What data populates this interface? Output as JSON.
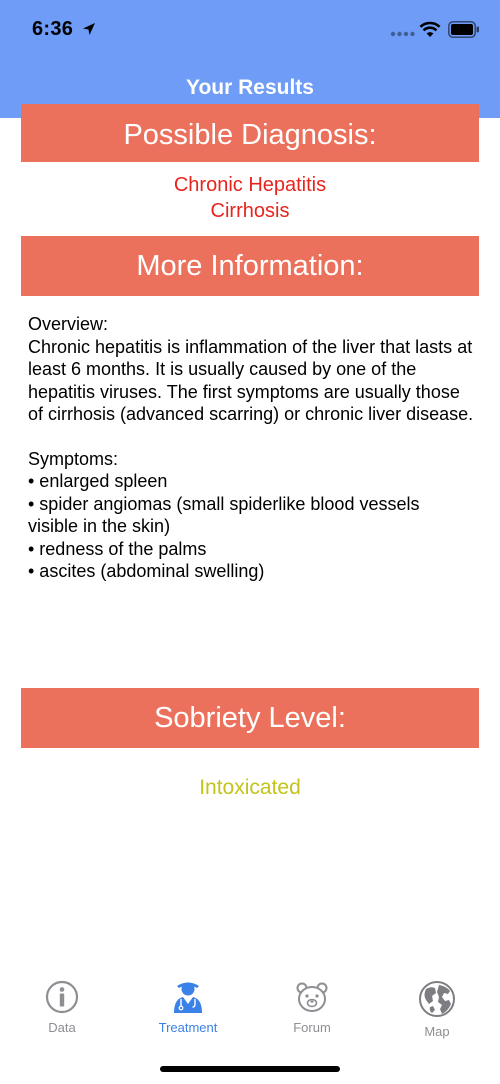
{
  "status_bar": {
    "time": "6:36"
  },
  "nav": {
    "title": "Your Results"
  },
  "sections": {
    "diagnosis_header": "Possible Diagnosis:",
    "diagnoses": [
      "Chronic Hepatitis",
      "Cirrhosis"
    ],
    "more_info_header": "More Information:",
    "sobriety_header": "Sobriety Level:",
    "sobriety_value": "Intoxicated"
  },
  "info": {
    "overview_label": "Overview:",
    "overview_text": "Chronic hepatitis is inflammation of the liver that lasts at least 6 months. It is usually caused by one of the hepatitis viruses. The first symptoms are usually those of cirrhosis (advanced scarring) or chronic liver disease.",
    "symptoms_label": "Symptoms:",
    "symptoms": [
      "• enlarged spleen",
      "• spider angiomas (small spiderlike blood vessels visible in the skin)",
      "• redness of the palms",
      "• ascites (abdominal swelling)"
    ]
  },
  "tabbar": {
    "items": [
      {
        "label": "Data",
        "icon": "info-icon"
      },
      {
        "label": "Treatment",
        "icon": "doctor-icon",
        "active": true
      },
      {
        "label": "Forum",
        "icon": "bear-icon"
      },
      {
        "label": "Map",
        "icon": "globe-icon"
      }
    ]
  },
  "colors": {
    "header": "#6e9cf6",
    "section_bar": "#ec715d",
    "diagnosis_text": "#e8241e",
    "sobriety_text": "#c3c31c",
    "tab_active": "#3b82e8",
    "tab_inactive": "#8e8e93"
  }
}
